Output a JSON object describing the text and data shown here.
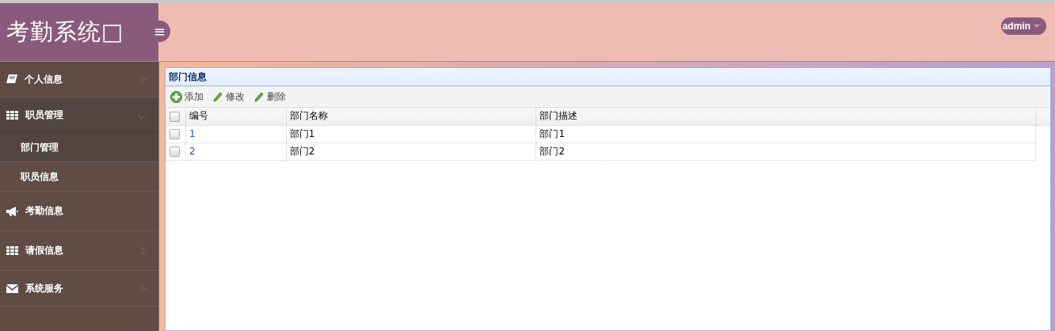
{
  "header": {
    "logo": "考勤系统□",
    "menu_toggle": "≡",
    "user": "admin"
  },
  "sidebar": {
    "items": [
      {
        "label": "个人信息",
        "kind": "group",
        "expanded": false
      },
      {
        "label": "职员管理",
        "kind": "group",
        "expanded": true,
        "children": [
          {
            "label": "部门管理",
            "selected": true
          },
          {
            "label": "职员信息",
            "selected": false
          }
        ]
      },
      {
        "label": "考勤信息",
        "kind": "link",
        "expanded": false
      },
      {
        "label": "请假信息",
        "kind": "group",
        "expanded": false
      },
      {
        "label": "系统服务",
        "kind": "group",
        "expanded": false
      }
    ]
  },
  "panel": {
    "title": "部门信息",
    "toolbar": [
      {
        "label": "添加",
        "kind": "add"
      },
      {
        "label": "修改",
        "kind": "edit"
      },
      {
        "label": "删除",
        "kind": "edit"
      }
    ],
    "table": {
      "select_all_checked": false,
      "columns": [
        "编号",
        "部门名称",
        "部门描述"
      ],
      "rows": [
        {
          "checked": false,
          "cells": [
            "1",
            "部门1",
            "部门1"
          ]
        },
        {
          "checked": false,
          "cells": [
            "2",
            "部门2",
            "部门2"
          ]
        }
      ]
    }
  }
}
